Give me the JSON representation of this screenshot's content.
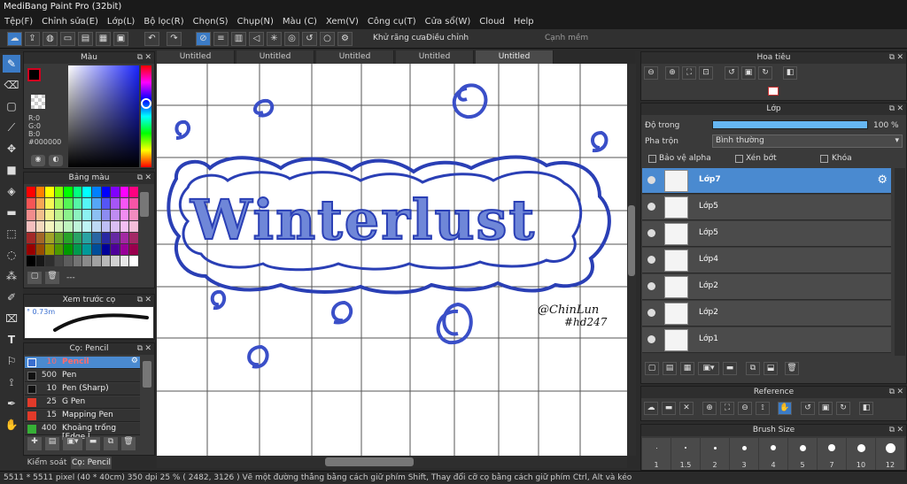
{
  "app": {
    "title": "MediBang Paint Pro (32bit)"
  },
  "menu": [
    "Tệp(F)",
    "Chỉnh sửa(E)",
    "Lớp(L)",
    "Bộ lọc(R)",
    "Chọn(S)",
    "Chụp(N)",
    "Màu (C)",
    "Xem(V)",
    "Công cụ(T)",
    "Cửa sổ(W)",
    "Cloud",
    "Help"
  ],
  "toolbar": {
    "antialias_label": "Khử răng cưa",
    "adjust_label": "Điều chỉnh",
    "adjust_value": "12",
    "edge_label": "Cạnh mềm"
  },
  "tabs": [
    "Untitled",
    "Untitled",
    "Untitled",
    "Untitled",
    "Untitled"
  ],
  "color_panel": {
    "title": "Màu",
    "r": "R:0",
    "g": "G:0",
    "b": "B:0",
    "hex": "#000000",
    "primary": "#000000",
    "secondary": "#ffffff",
    "accent": "#d1001f"
  },
  "palette_panel": {
    "title": "Bảng màu",
    "footer": "---"
  },
  "brush_preview": {
    "title": "Xem trước cọ",
    "size": "0.73m"
  },
  "brush_panel": {
    "title": "Cọ: Pencil",
    "items": [
      {
        "size": "10",
        "name": "Pencil",
        "color": "#3a6fd0"
      },
      {
        "size": "500",
        "name": "Pen",
        "color": "#111111"
      },
      {
        "size": "10",
        "name": "Pen (Sharp)",
        "color": "#111111"
      },
      {
        "size": "25",
        "name": "G Pen",
        "color": "#e23a2a"
      },
      {
        "size": "15",
        "name": "Mapping Pen",
        "color": "#e23a2a"
      },
      {
        "size": "400",
        "name": "Khoảng trống [Edge l",
        "color": "#36b036"
      }
    ]
  },
  "bottom_tabs": [
    "Kiểm soát co",
    "Cọ: Pencil"
  ],
  "navigator": {
    "title": "Hoa tiêu"
  },
  "layer_panel": {
    "title": "Lớp",
    "opacity_label": "Độ trong",
    "opacity_value": "100 %",
    "blend_label": "Pha trộn",
    "blend_value": "Bình thường",
    "protect_alpha": "Bảo vệ alpha",
    "clip": "Xén bớt",
    "lock": "Khóa",
    "opacity": 1.0,
    "layers": [
      "Lớp7",
      "Lớp5",
      "Lớp5",
      "Lớp4",
      "Lớp2",
      "Lớp2",
      "Lớp1"
    ]
  },
  "reference": {
    "title": "Reference"
  },
  "brush_size": {
    "title": "Brush Size",
    "sizes": [
      "1",
      "1.5",
      "2",
      "3",
      "4",
      "5",
      "7",
      "10",
      "12"
    ]
  },
  "artwork": {
    "title_text": "Winterlust",
    "signature_line1": "@ChinLun",
    "signature_line2": "#hd247"
  },
  "status": {
    "text": "5511 * 5511 pixel   (40 * 40cm)   350 dpi   25 %   ( 2482, 3126 )   Vẽ một đường thẳng bằng cách giữ phím Shift, Thay đổi cỡ cọ bằng cách giữ phím Ctrl, Alt và kéo"
  }
}
